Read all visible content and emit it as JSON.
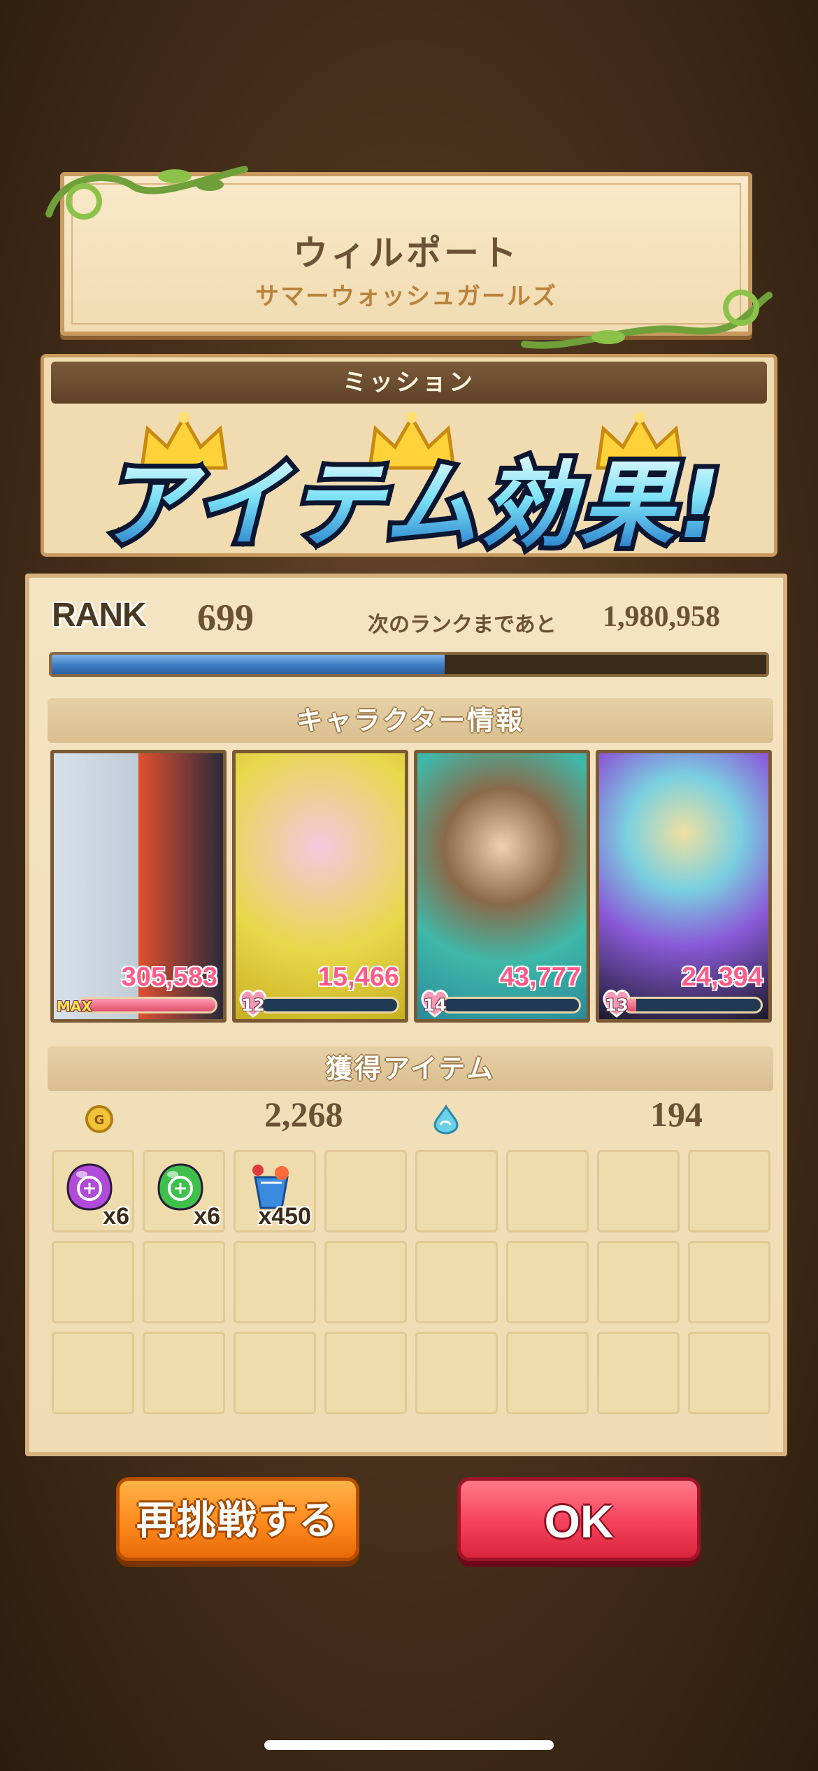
{
  "header": {
    "stage_title": "ウィルポート",
    "event_subtitle": "サマーウォッシュガールズ"
  },
  "mission": {
    "title": "ミッション",
    "crowns": [
      "gold",
      "gold",
      "gold"
    ],
    "banner_text": "アイテム効果!"
  },
  "rank": {
    "label": "RANK",
    "value": "699",
    "next_label": "次のランクまであと",
    "next_value": "1,980,958",
    "progress": 0.55
  },
  "character_section": {
    "title": "キャラクター情報",
    "characters": [
      {
        "score": "305,583",
        "level": "MAX",
        "gauge": 1.0,
        "bg": "#d8e0ea"
      },
      {
        "score": "15,466",
        "level": "12",
        "gauge": 0.0,
        "bg": "#e8d84a"
      },
      {
        "score": "43,777",
        "level": "14",
        "gauge": 0.0,
        "bg": "#3fb8a8"
      },
      {
        "score": "24,394",
        "level": "13",
        "gauge": 0.08,
        "bg": "#8a5ad8"
      }
    ]
  },
  "items_section": {
    "title": "獲得アイテム",
    "gold_icon": "gold-coin-icon",
    "gold_value": "2,268",
    "exp_icon": "blue-drop-icon",
    "exp_value": "194",
    "items": [
      {
        "icon": "purple-orb-icon",
        "count": "x6",
        "color": "#b04ad8"
      },
      {
        "icon": "green-orb-icon",
        "count": "x6",
        "color": "#3ec04a"
      },
      {
        "icon": "tropical-drink-icon",
        "count": "x450",
        "color": "#3a8ae0"
      }
    ],
    "total_slots": 24
  },
  "buttons": {
    "retry": "再挑戦する",
    "ok": "OK"
  }
}
